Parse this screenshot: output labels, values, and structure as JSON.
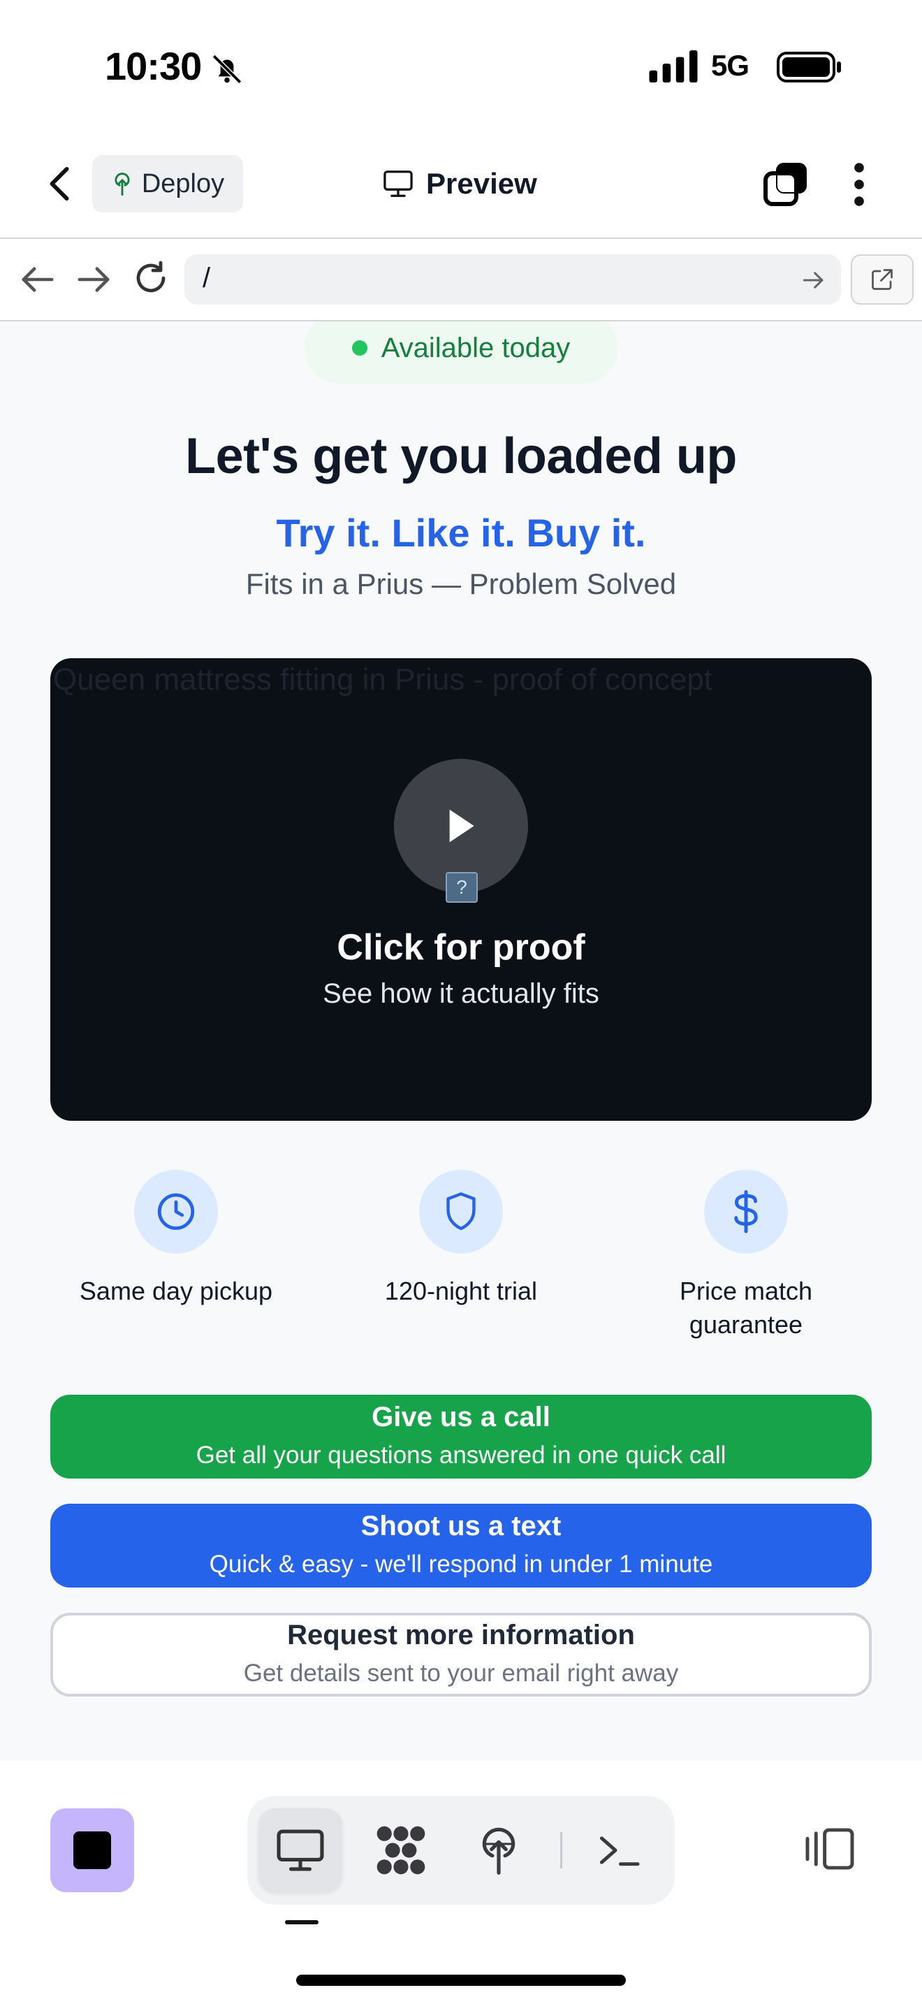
{
  "status_bar": {
    "time": "10:30",
    "network": "5G",
    "icons": [
      "bell-slash-icon",
      "cellular-signal-icon",
      "battery-icon"
    ]
  },
  "top_bar": {
    "deploy_label": "Deploy",
    "title": "Preview",
    "icons": [
      "chevron-left-icon",
      "tree-icon",
      "monitor-icon",
      "tabs-icon",
      "more-vertical-icon"
    ]
  },
  "browser": {
    "url": "/",
    "icons": [
      "arrow-left-icon",
      "arrow-right-icon",
      "reload-icon",
      "arrow-right-small-icon",
      "external-link-icon"
    ]
  },
  "page": {
    "badge": "Available today",
    "title": "Let's get you loaded up",
    "tagline": "Try it. Like it. Buy it.",
    "subtitle": "Fits in a Prius — Problem Solved",
    "video": {
      "alt_text": "Queen mattress fitting in Prius - proof of concept",
      "broken_image_glyph": "?",
      "title": "Click for proof",
      "subtitle": "See how it actually fits"
    },
    "features": [
      {
        "icon": "clock-icon",
        "label": "Same day pickup"
      },
      {
        "icon": "shield-icon",
        "label": "120-night trial"
      },
      {
        "icon": "dollar-icon",
        "label": "Price match guarantee"
      }
    ],
    "ctas": {
      "call": {
        "title": "Give us a call",
        "subtitle": "Get all your questions answered in one quick call",
        "color": "#16a34a"
      },
      "text": {
        "title": "Shoot us a text",
        "subtitle": "Quick & easy - we'll respond in under 1 minute",
        "color": "#2563eb"
      },
      "info": {
        "title": "Request more information",
        "subtitle": "Get details sent to your email right away"
      }
    }
  },
  "bottom_toolbar": {
    "items": [
      "preview-monitor-icon",
      "modules-icon",
      "deploy-tree-icon",
      "terminal-icon"
    ],
    "active": "preview-monitor-icon",
    "accent": "#c4b5fd"
  }
}
